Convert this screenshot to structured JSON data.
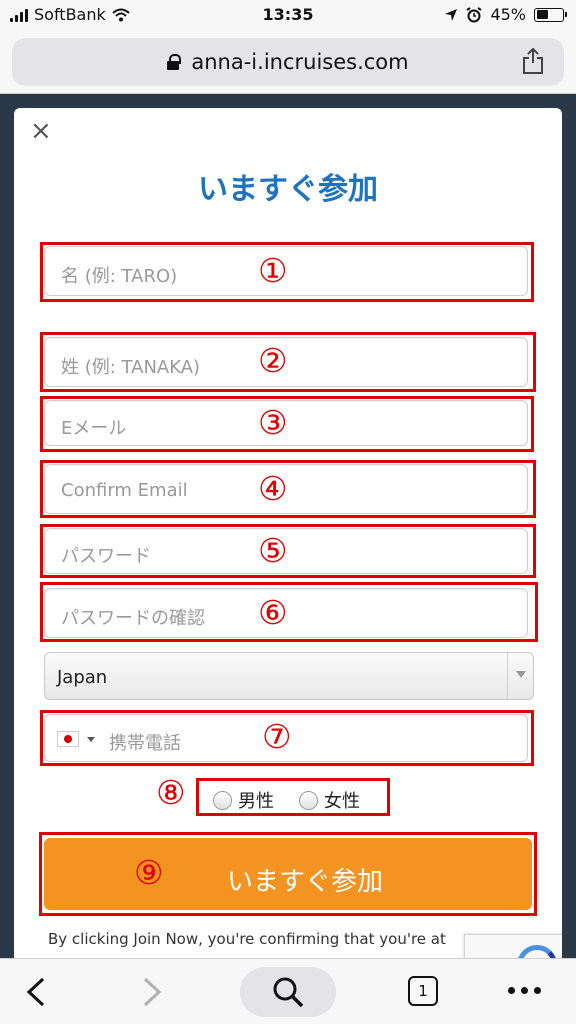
{
  "status_bar": {
    "carrier": "SoftBank",
    "time": "13:35",
    "battery": "45%",
    "battery_level": 0.45
  },
  "browser": {
    "url": "anna-i.incruises.com",
    "tab_count": "1"
  },
  "modal": {
    "close_glyph": "×",
    "title": "いますぐ参加",
    "fields": {
      "first_name": "名 (例: TARO)",
      "last_name": "姓 (例: TANAKA)",
      "email": "Eメール",
      "confirm_email": "Confirm Email",
      "password": "パスワード",
      "confirm_password": "パスワードの確認",
      "country": "Japan",
      "phone": "携帯電話"
    },
    "gender": {
      "male": "男性",
      "female": "女性"
    },
    "join_button": "いますぐ参加",
    "disclaimer": "By clicking Join Now, you're confirming that you're at"
  },
  "annotations": [
    "①",
    "②",
    "③",
    "④",
    "⑤",
    "⑥",
    "⑦",
    "⑧",
    "⑨"
  ],
  "colors": {
    "title": "#1e73be",
    "join_button": "#f39322",
    "annotation": "#e00000",
    "overlay": "#2a3848"
  },
  "icons": [
    "signal-icon",
    "wifi-icon",
    "location-icon",
    "alarm-icon",
    "battery-icon",
    "lock-icon",
    "share-icon",
    "close-icon",
    "flag-japan-icon",
    "back-icon",
    "forward-icon",
    "search-icon",
    "tabs-icon",
    "more-icon",
    "recaptcha-icon"
  ]
}
